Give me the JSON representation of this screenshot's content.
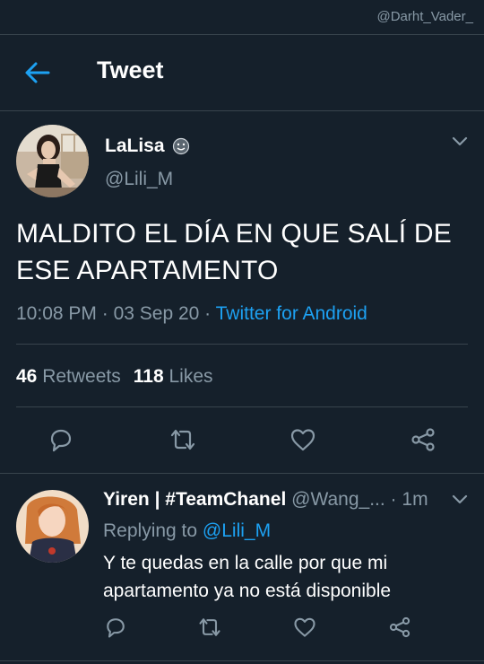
{
  "watermark": "@Darht_Vader_",
  "header": {
    "title": "Tweet",
    "back_icon": "arrow-left-icon"
  },
  "colors": {
    "background": "#15202b",
    "accent": "#1da1f2",
    "muted": "#8899a6",
    "divider": "#38444d"
  },
  "tweet": {
    "display_name": "LaLisa",
    "name_emoji": "smiling-face-icon",
    "handle": "@Lili_M",
    "text": "MALDITO EL DÍA EN QUE SALÍ DE ESE APARTAMENTO",
    "time": "10:08 PM",
    "date": "03 Sep 20",
    "source": "Twitter for Android",
    "retweets_count": "46",
    "retweets_label": "Retweets",
    "likes_count": "118",
    "likes_label": "Likes"
  },
  "reply": {
    "display_name": "Yiren | #TeamChanel",
    "handle": "@Wang_...",
    "time": "1m",
    "replying_prefix": "Replying to",
    "replying_to": "@Lili_M",
    "text": "Y te quedas en la calle por que mi apartamento ya no está disponible"
  },
  "action_icons": [
    "reply-icon",
    "retweet-icon",
    "like-icon",
    "share-icon"
  ]
}
